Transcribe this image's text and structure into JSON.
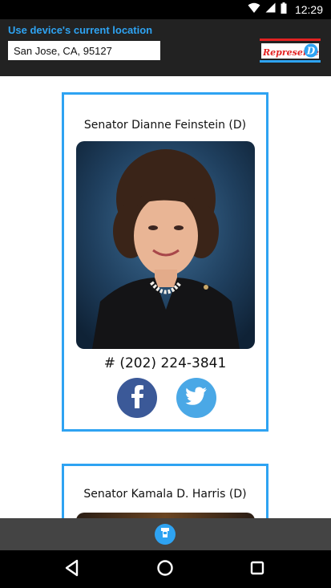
{
  "status_bar": {
    "time": "12:29",
    "icons": [
      "wifi-icon",
      "signal-icon",
      "battery-icon"
    ]
  },
  "header": {
    "location_link": "Use device's current location",
    "location_value": "San Jose, CA, 95127",
    "logo_text": "Represente",
    "logo_letter": "D"
  },
  "cards": [
    {
      "name": "Senator Dianne Feinstein (D)",
      "phone": "# (202) 224-3841",
      "social": [
        "facebook-icon",
        "twitter-icon"
      ]
    },
    {
      "name": "Senator Kamala D. Harris (D)"
    }
  ],
  "colors": {
    "accent": "#2ea3f2",
    "header_bg": "#222222",
    "bottom_bar_bg": "#444444",
    "facebook": "#3b5998",
    "twitter": "#4aa8e6"
  },
  "nav_bar": [
    "back-icon",
    "home-icon",
    "recents-icon"
  ]
}
